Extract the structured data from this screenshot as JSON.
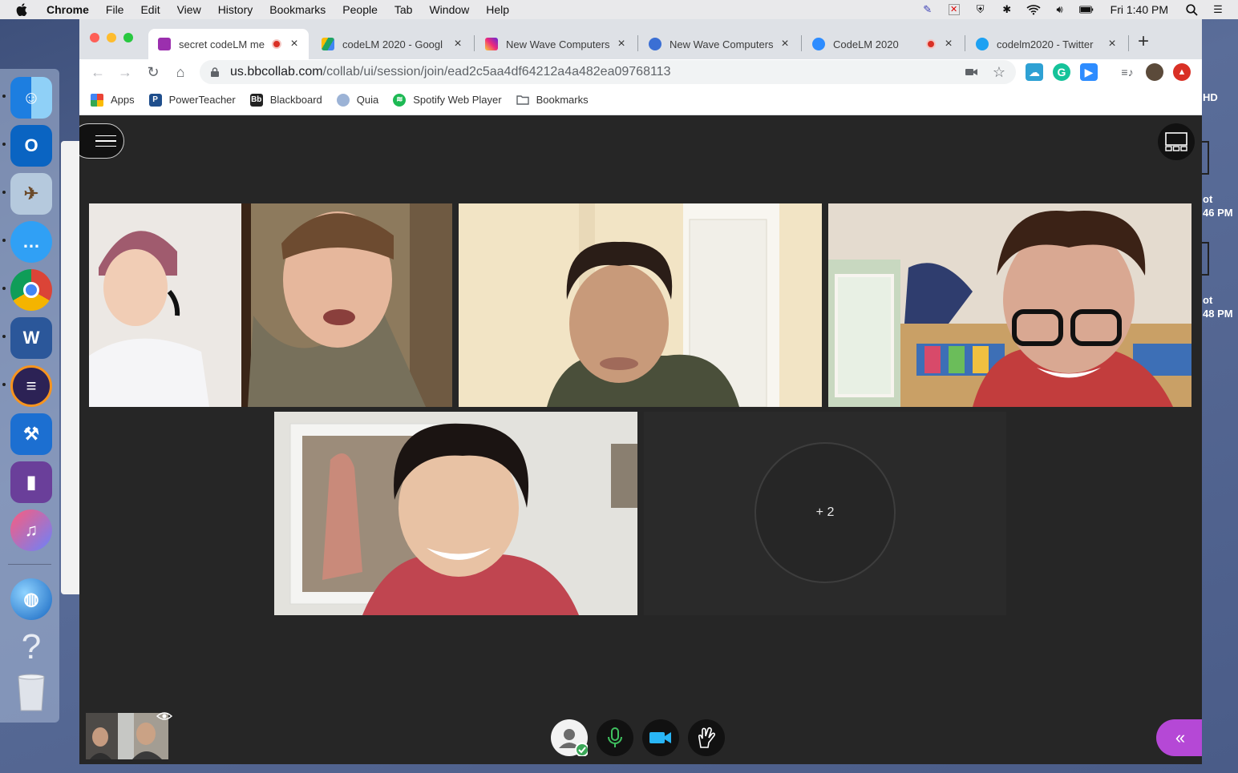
{
  "menubar": {
    "app": "Chrome",
    "items": [
      "File",
      "Edit",
      "View",
      "History",
      "Bookmarks",
      "People",
      "Tab",
      "Window",
      "Help"
    ],
    "clock": "Fri 1:40 PM",
    "status_icons": [
      "pen-icon",
      "close-box-icon",
      "shield-icon",
      "bluetooth-icon",
      "wifi-icon",
      "volume-icon",
      "battery-icon",
      "search-icon",
      "list-icon"
    ]
  },
  "tabs": [
    {
      "title": "secret codeLM me",
      "favicon": "#9b2fae",
      "active": true,
      "recording": true
    },
    {
      "title": "codeLM 2020 - Googl",
      "favicon": "#1fa463",
      "active": false,
      "recording": false
    },
    {
      "title": "New Wave Computers",
      "favicon": "#d6249f",
      "active": false,
      "recording": false
    },
    {
      "title": "New Wave Computers",
      "favicon": "#3b6fd4",
      "active": false,
      "recording": false
    },
    {
      "title": "CodeLM 2020",
      "favicon": "#2d8cff",
      "active": false,
      "recording": true
    },
    {
      "title": "codelm2020 - Twitter",
      "favicon": "#1da1f2",
      "active": false,
      "recording": false
    }
  ],
  "omnibox": {
    "domain": "us.bbcollab.com",
    "path": "/collab/ui/session/join/ead2c5aa4df64212a4a482ea09768113"
  },
  "bookmarks": [
    {
      "label": "Apps",
      "icon": "apps-icon"
    },
    {
      "label": "PowerTeacher",
      "icon": "powerteacher-icon"
    },
    {
      "label": "Blackboard",
      "icon": "blackboard-icon"
    },
    {
      "label": "Quia",
      "icon": "quia-icon"
    },
    {
      "label": "Spotify Web Player",
      "icon": "spotify-icon"
    },
    {
      "label": "Bookmarks",
      "icon": "folder-icon"
    }
  ],
  "session": {
    "overflow_label": "+ 2"
  },
  "background_window": {
    "hd": "HD",
    "item1_a": "ot",
    "item1_b": "46 PM",
    "item2_a": "ot",
    "item2_b": "48 PM"
  },
  "colors": {
    "accent": "#b548d6",
    "mic": "#3fbf5f",
    "camera": "#29b6f6",
    "recording": "#d93025"
  }
}
